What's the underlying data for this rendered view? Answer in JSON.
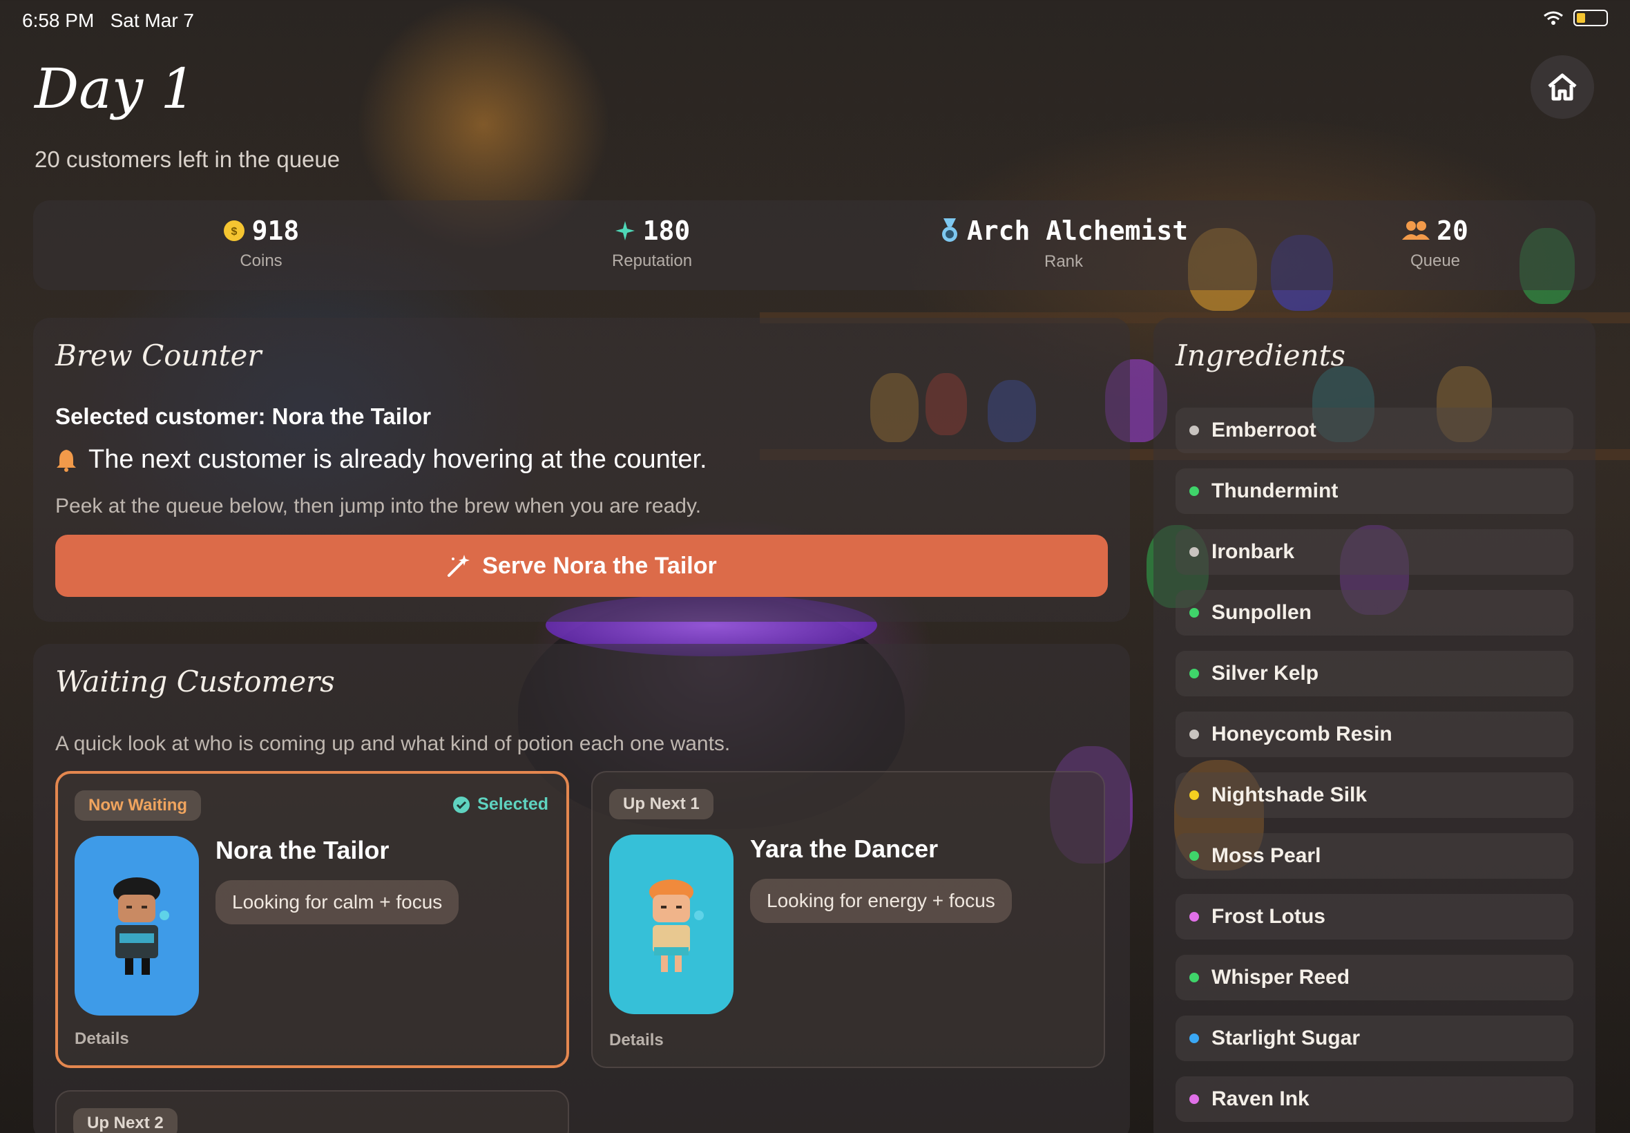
{
  "status_bar": {
    "time": "6:58 PM",
    "date": "Sat Mar 7"
  },
  "header": {
    "title": "Day 1",
    "subtitle": "20 customers left in the queue",
    "home_icon": "house-icon"
  },
  "stats": [
    {
      "value": "918",
      "label": "Coins",
      "icon": "coin-icon",
      "color": "#f5c531"
    },
    {
      "value": "180",
      "label": "Reputation",
      "icon": "sparkle-icon",
      "color": "#4fd8b8"
    },
    {
      "value": "Arch Alchemist",
      "label": "Rank",
      "icon": "medal-icon",
      "color": "#7ec8f0"
    },
    {
      "value": "20",
      "label": "Queue",
      "icon": "people-icon",
      "color": "#f29a4a"
    }
  ],
  "brew_counter": {
    "title": "Brew Counter",
    "selected_text": "Selected customer: Nora the Tailor",
    "alert_text": "The next customer is already hovering at the counter.",
    "hint_text": "Peek at the queue below, then jump into the brew when you are ready.",
    "serve_button": "Serve Nora the Tailor",
    "accent": "#dc6b49"
  },
  "waiting": {
    "title": "Waiting Customers",
    "description": "A quick look at who is coming up and what kind of potion each one wants.",
    "cards": [
      {
        "badge": "Now Waiting",
        "selected_label": "Selected",
        "name": "Nora the Tailor",
        "want": "Looking for calm + focus",
        "details": "Details",
        "portrait_color": "#3e9be8"
      },
      {
        "badge": "Up Next 1",
        "name": "Yara the Dancer",
        "want": "Looking for energy + focus",
        "details": "Details",
        "portrait_color": "#36c0d8"
      },
      {
        "badge": "Up Next 2"
      }
    ]
  },
  "ingredients": {
    "title": "Ingredients",
    "items": [
      {
        "name": "Emberroot",
        "color": "#c9c4c0"
      },
      {
        "name": "Thundermint",
        "color": "#3fd46a"
      },
      {
        "name": "Ironbark",
        "color": "#c9c4c0"
      },
      {
        "name": "Sunpollen",
        "color": "#3fd46a"
      },
      {
        "name": "Silver Kelp",
        "color": "#3fd46a"
      },
      {
        "name": "Honeycomb Resin",
        "color": "#c9c4c0"
      },
      {
        "name": "Nightshade Silk",
        "color": "#f5d020"
      },
      {
        "name": "Moss Pearl",
        "color": "#3fd46a"
      },
      {
        "name": "Frost Lotus",
        "color": "#e070e8"
      },
      {
        "name": "Whisper Reed",
        "color": "#3fd46a"
      },
      {
        "name": "Starlight Sugar",
        "color": "#3aa8f5"
      },
      {
        "name": "Raven Ink",
        "color": "#e070e8"
      }
    ]
  }
}
